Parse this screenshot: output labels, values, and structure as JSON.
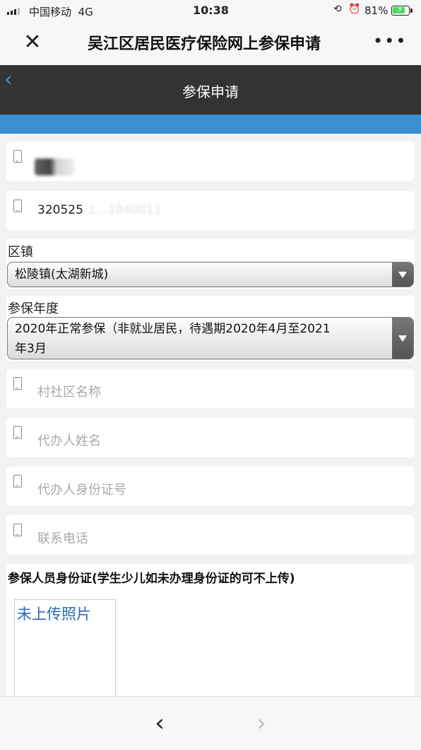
{
  "status_bar": {
    "carrier": "中国移动",
    "network": "4G",
    "time": "10:38",
    "battery_percent": "81%",
    "battery_level": 0.81,
    "signal_icon": "signal-bars-icon",
    "rotation_lock_icon": "rotation-lock-icon",
    "alarm_icon": "alarm-clock-icon",
    "battery_icon": "battery-charging-icon"
  },
  "webview": {
    "title": "吴江区居民医疗保险网上参保申请",
    "close_icon": "close-icon",
    "more_icon": "more-dots-icon"
  },
  "header": {
    "title": "参保申请",
    "back_icon": "chevron-left-icon",
    "color_bg": "#333333",
    "color_strip": "#3a8fd1"
  },
  "form": {
    "name_value": "",
    "id_value": "320525",
    "id_value_obscured": "1…1040011",
    "district_label": "区镇",
    "district_value": "松陵镇(太湖新城)",
    "year_label": "参保年度",
    "year_value_line1": "2020年正常参保（非就业居民，待遇期2020年4月至2021",
    "year_value_line2": "年3月",
    "community_placeholder": "村社区名称",
    "agent_name_placeholder": "代办人姓名",
    "agent_id_placeholder": "代办人身份证号",
    "phone_placeholder": "联系电话",
    "field_icon": "mobile-phone-icon"
  },
  "upload": {
    "label": "参保人员身份证(学生少儿如未办理身份证的可不上传)",
    "photo_status": "未上传照片"
  },
  "bottom_nav": {
    "prev_icon": "chevron-left-icon",
    "next_icon": "chevron-right-icon",
    "prev_symbol": "‹",
    "next_symbol": "›"
  }
}
